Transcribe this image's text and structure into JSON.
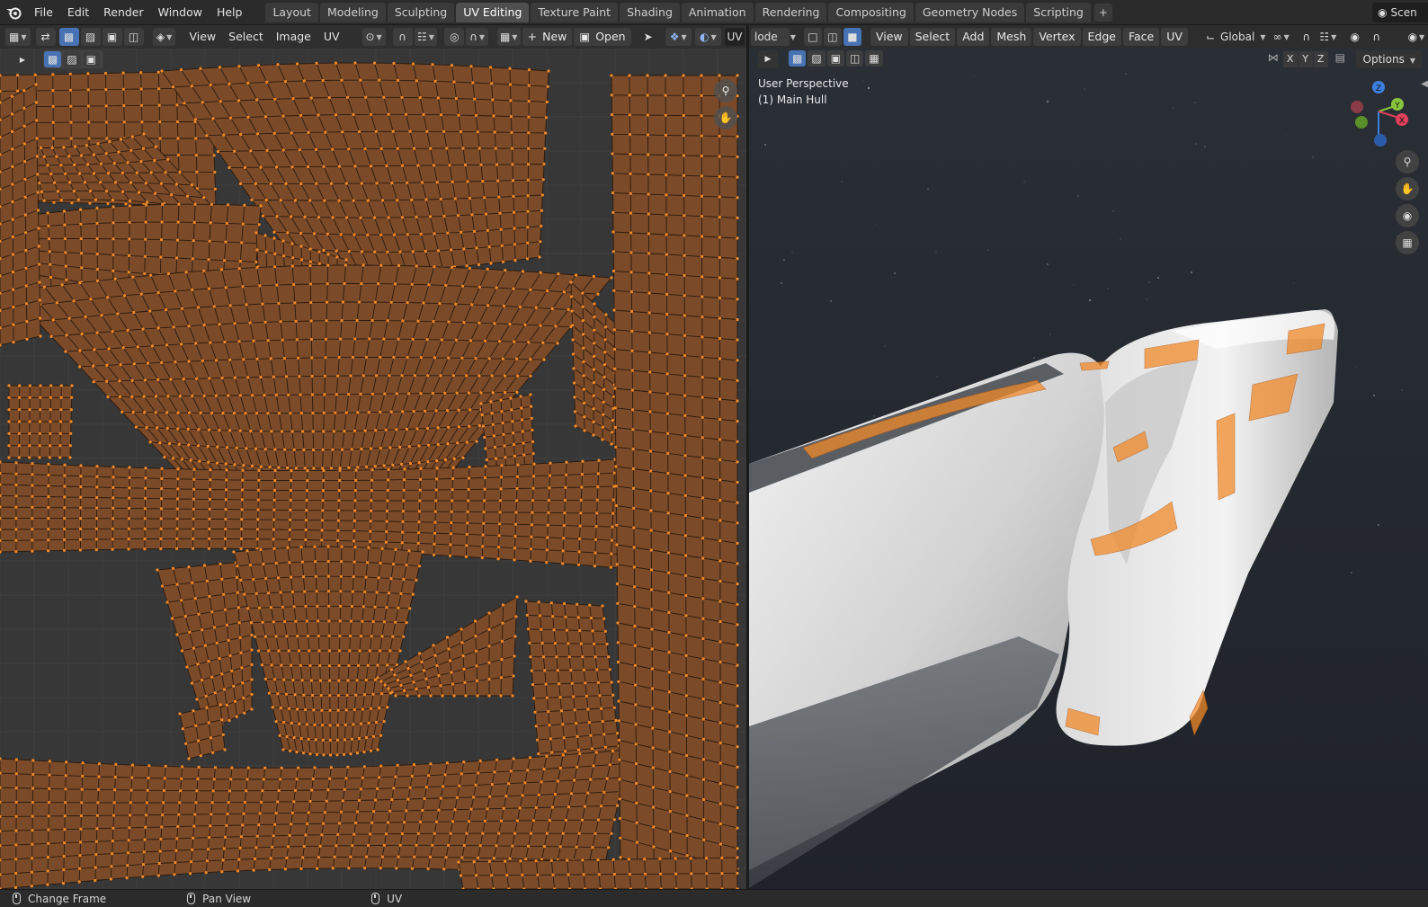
{
  "menu": [
    "File",
    "Edit",
    "Render",
    "Window",
    "Help"
  ],
  "workspaces": [
    "Layout",
    "Modeling",
    "Sculpting",
    "UV Editing",
    "Texture Paint",
    "Shading",
    "Animation",
    "Rendering",
    "Compositing",
    "Geometry Nodes",
    "Scripting"
  ],
  "active_workspace": "UV Editing",
  "scene_label": "Scen",
  "uv_editor": {
    "menus": [
      "View",
      "Select",
      "Image",
      "UV"
    ],
    "new_label": "New",
    "open_label": "Open",
    "mode_label": "UV"
  },
  "viewport": {
    "mode_label": "lode",
    "menus": [
      "View",
      "Select",
      "Add",
      "Mesh",
      "Vertex",
      "Edge",
      "Face",
      "UV"
    ],
    "orientation": "Global",
    "perspective_label": "User Perspective",
    "object_label": "(1) Main Hull",
    "axis_toggles": [
      "X",
      "Y",
      "Z"
    ],
    "options_label": "Options",
    "gizmo_axes": [
      "Z",
      "Y",
      "X"
    ]
  },
  "statusbar": {
    "items": [
      "Change Frame",
      "Pan View",
      "UV"
    ]
  },
  "colors": {
    "uv_mesh": "#f08a2a",
    "uv_fill": "#7b4a28",
    "accent": "#4772b3",
    "axis_x": "#e0405a",
    "axis_y": "#8ac43c",
    "axis_z": "#3c7fe0"
  }
}
